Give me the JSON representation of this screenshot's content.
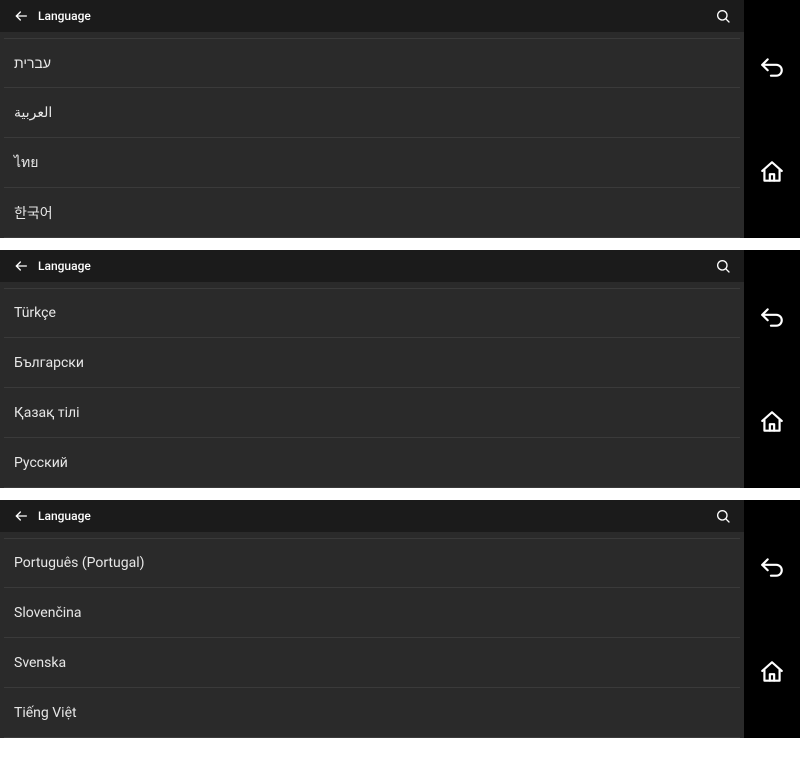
{
  "panels": [
    {
      "title": "Language",
      "items": [
        "עברית",
        "العربية",
        "ไทย",
        "한국어"
      ]
    },
    {
      "title": "Language",
      "items": [
        "Türkçe",
        "Български",
        "Қазақ тілі",
        "Русский"
      ]
    },
    {
      "title": "Language",
      "items": [
        "Português (Portugal)",
        "Slovenčina",
        "Svenska",
        "Tiếng Việt"
      ]
    }
  ]
}
